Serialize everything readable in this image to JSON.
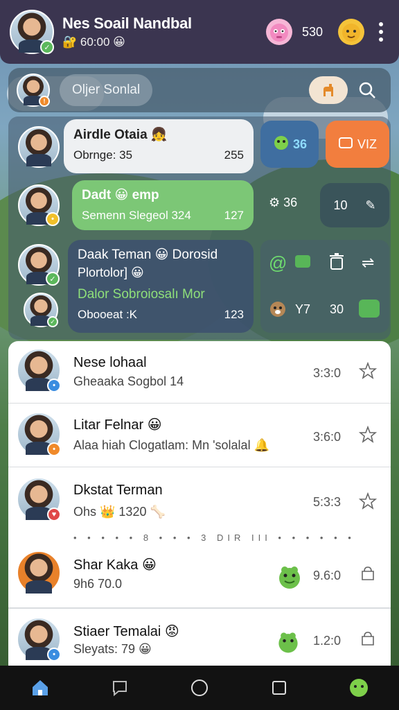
{
  "header": {
    "title": "Nes Soail Nandbal",
    "subtitle": "🔐 60:00 😀",
    "count": "530",
    "mascot1": "pink-monster-icon",
    "mascot2": "yellow-creature-icon",
    "menu_icon": "kebab-menu-icon"
  },
  "search": {
    "placeholder": "Oljer Sonlal",
    "filter_icon": "llama-icon",
    "search_icon": "search-icon"
  },
  "groups": {
    "item1": {
      "name": "Airdle Otaia 👧",
      "sub": "Obrnge: 35",
      "count": "255"
    },
    "item2": {
      "name": "Dadt 😀 emp",
      "sub": "Semenn Slegeol 324",
      "count": "127"
    },
    "item3": {
      "name": "Daak Teman 😀 Dorosid",
      "sub": "Plortolor] 😀"
    },
    "item4": {
      "name": "Dalor Sobroiosalı Mor",
      "sub": "Obooeat :K",
      "count": "123"
    },
    "tiles": {
      "t1": "36",
      "t2": "VIZ",
      "t3": "36",
      "t4": "10",
      "t5": "Y7",
      "t6": "30"
    }
  },
  "list": [
    {
      "name": "Nese lohaal",
      "sub": "Gheaaka Sogbol 14",
      "time": "3:3:0"
    },
    {
      "name": "Litar Felnar 😀",
      "sub": "Alaa hiah Clogatlam: Mn 'solalal 🔔",
      "time": "3:6:0"
    },
    {
      "name": "Dkstat Terman",
      "sub": "Ohs 👑 1320 🦴",
      "time": "5:3:3"
    },
    {
      "name": "Shar Kaka 😀",
      "sub": "9h6 70.0",
      "time": "9.6:0"
    },
    {
      "name": "Stiaer Temalai 😡",
      "sub": "Sleyats: 79 😀",
      "time": "1.2:0"
    }
  ],
  "symbol_line": "• • • • • 8 • • • 3 DIR III • • • • • •",
  "nav": [
    "home-icon",
    "chat-icon",
    "circle-home-icon",
    "square-recent-icon",
    "green-creature-icon"
  ]
}
